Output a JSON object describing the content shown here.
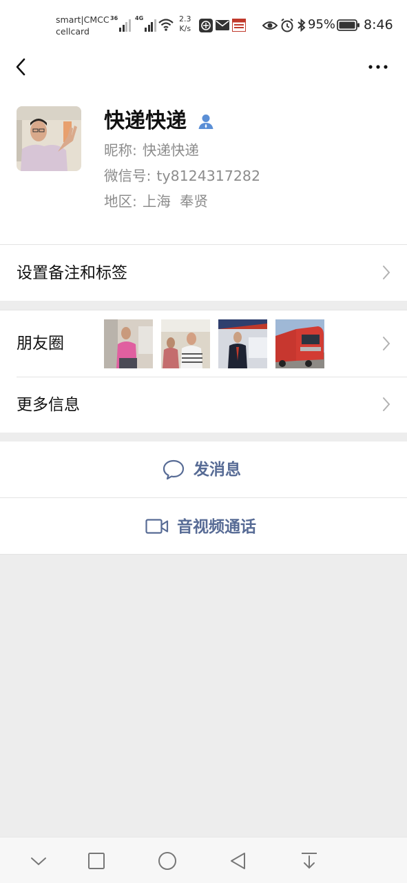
{
  "status_bar": {
    "carrier_line1": "smart|CMCC",
    "carrier_line2": "cellcard",
    "sig1_tag": "36",
    "sig2_tag": "4G",
    "net_speed_value": "2.3",
    "net_speed_unit": "K/s",
    "battery_percent": "95%",
    "time": "8:46"
  },
  "nav": {
    "back_icon": "chevron-left-icon",
    "more_icon": "more-dots-icon"
  },
  "profile": {
    "name": "快递快递",
    "nickname_label": "昵称:",
    "nickname": "快递快递",
    "wechat_id_label": "微信号:",
    "wechat_id": "ty8124317282",
    "region_label": "地区:",
    "region": "上海  奉贤"
  },
  "rows": {
    "remark_tags": "设置备注和标签",
    "moments": "朋友圈",
    "more_info": "更多信息"
  },
  "actions": {
    "send_message": "发消息",
    "video_call": "音视频通话"
  },
  "colors": {
    "accent_link": "#576b95",
    "background": "#ededed",
    "verified": "#5b8fd6"
  }
}
